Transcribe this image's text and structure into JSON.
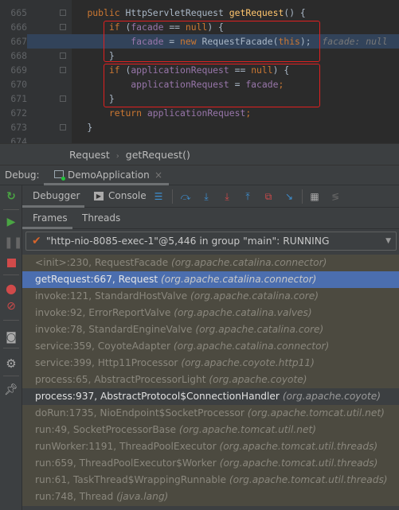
{
  "editor": {
    "lines": [
      {
        "n": "665",
        "parts": [
          [
            "",
            "    "
          ],
          [
            "kw",
            "public "
          ],
          [
            "",
            "HttpServletRequest "
          ],
          [
            "fn",
            "getRequest"
          ],
          [
            "",
            "() {"
          ]
        ]
      },
      {
        "n": "666",
        "parts": [
          [
            "",
            "        "
          ],
          [
            "kw",
            "if "
          ],
          [
            "",
            "("
          ],
          [
            "fld",
            "facade"
          ],
          [
            "",
            " == "
          ],
          [
            "kw",
            "null"
          ],
          [
            "",
            ") {"
          ]
        ]
      },
      {
        "n": "667",
        "parts": [
          [
            "",
            "            "
          ],
          [
            "fld",
            "facade"
          ],
          [
            "",
            " = "
          ],
          [
            "kw",
            "new "
          ],
          [
            "",
            "RequestFacade("
          ],
          [
            "kw",
            "this"
          ],
          [
            "",
            ");"
          ]
        ],
        "hint": "facade: null"
      },
      {
        "n": "668",
        "parts": [
          [
            "",
            "        }"
          ]
        ]
      },
      {
        "n": "669",
        "parts": [
          [
            "",
            "        "
          ],
          [
            "kw",
            "if "
          ],
          [
            "",
            "("
          ],
          [
            "fld",
            "applicationRequest"
          ],
          [
            "",
            " == "
          ],
          [
            "kw",
            "null"
          ],
          [
            "",
            ") {"
          ]
        ]
      },
      {
        "n": "670",
        "parts": [
          [
            "",
            "            "
          ],
          [
            "fld",
            "applicationRequest"
          ],
          [
            "",
            " = "
          ],
          [
            "fld",
            "facade"
          ],
          [
            "kw",
            ";"
          ]
        ]
      },
      {
        "n": "671",
        "parts": [
          [
            "",
            "        }"
          ]
        ]
      },
      {
        "n": "672",
        "parts": [
          [
            "",
            "        "
          ],
          [
            "kw",
            "return "
          ],
          [
            "fld",
            "applicationRequest"
          ],
          [
            "kw",
            ";"
          ]
        ]
      },
      {
        "n": "673",
        "parts": [
          [
            "",
            "    }"
          ]
        ]
      },
      {
        "n": "674",
        "parts": []
      }
    ],
    "current_line": "667"
  },
  "breadcrumb": {
    "class": "Request",
    "method": "getRequest()"
  },
  "debug": {
    "label": "Debug:",
    "tab": "DemoApplication",
    "close": "×"
  },
  "toolbar": {
    "debugger": "Debugger",
    "console": "Console"
  },
  "frame_tabs": {
    "frames": "Frames",
    "threads": "Threads"
  },
  "thread": {
    "text": "\"http-nio-8085-exec-1\"@5,446 in group \"main\": RUNNING",
    "status_icon": "checkmark-icon"
  },
  "frames": [
    {
      "m": "<init>:230, RequestFacade",
      "p": "(org.apache.catalina.connector)"
    },
    {
      "m": "getRequest:667, Request",
      "p": "(org.apache.catalina.connector)",
      "state": "selected"
    },
    {
      "m": "invoke:121, StandardHostValve",
      "p": "(org.apache.catalina.core)"
    },
    {
      "m": "invoke:92, ErrorReportValve",
      "p": "(org.apache.catalina.valves)"
    },
    {
      "m": "invoke:78, StandardEngineValve",
      "p": "(org.apache.catalina.core)"
    },
    {
      "m": "service:359, CoyoteAdapter",
      "p": "(org.apache.catalina.connector)"
    },
    {
      "m": "service:399, Http11Processor",
      "p": "(org.apache.coyote.http11)"
    },
    {
      "m": "process:65, AbstractProcessorLight",
      "p": "(org.apache.coyote)"
    },
    {
      "m": "process:937, AbstractProtocol$ConnectionHandler",
      "p": "(org.apache.coyote)",
      "state": "active"
    },
    {
      "m": "doRun:1735, NioEndpoint$SocketProcessor",
      "p": "(org.apache.tomcat.util.net)"
    },
    {
      "m": "run:49, SocketProcessorBase",
      "p": "(org.apache.tomcat.util.net)"
    },
    {
      "m": "runWorker:1191, ThreadPoolExecutor",
      "p": "(org.apache.tomcat.util.threads)"
    },
    {
      "m": "run:659, ThreadPoolExecutor$Worker",
      "p": "(org.apache.tomcat.util.threads)"
    },
    {
      "m": "run:61, TaskThread$WrappingRunnable",
      "p": "(org.apache.tomcat.util.threads)"
    },
    {
      "m": "run:748, Thread",
      "p": "(java.lang)"
    }
  ],
  "colors": {
    "selected": "#4b6eaf",
    "highlight_box": "#e02020",
    "keyword": "#cc7832",
    "field": "#9876aa",
    "method": "#ffc66d"
  }
}
